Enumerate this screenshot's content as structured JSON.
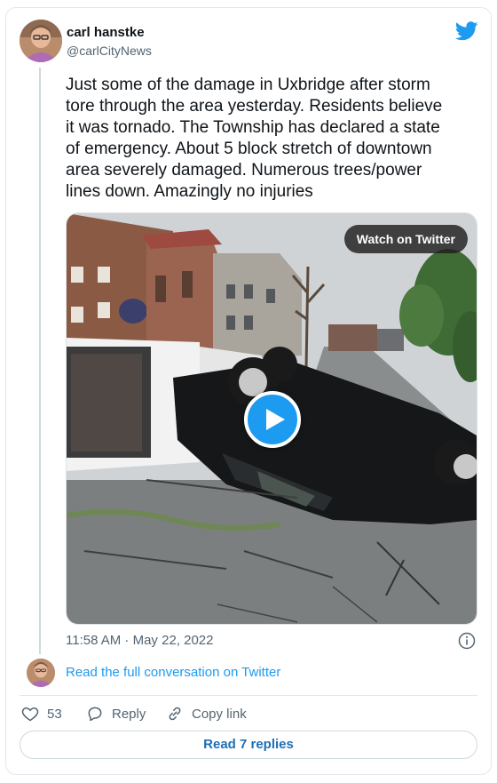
{
  "tweet": {
    "author_name": "carl hanstke",
    "author_handle": "@carlCityNews",
    "text": "Just some of the damage in Uxbridge after storm\ntore through the area yesterday.  Residents believe\nit was tornado.  The Township has declared a state\nof emergency.  About 5 block stretch of downtown\narea severely damaged. Numerous trees/power\nlines down.  Amazingly no injuries",
    "timestamp": "11:58 AM · May 22, 2022"
  },
  "media": {
    "watch_label": "Watch on Twitter"
  },
  "conversation_link": "Read the full conversation on Twitter",
  "actions": {
    "likes": "53",
    "reply_label": "Reply",
    "copy_label": "Copy link"
  },
  "replies_button": "Read 7 replies",
  "colors": {
    "brand": "#1d9bf0",
    "text": "#0f1419",
    "muted": "#536471",
    "border": "#e1e8ed"
  },
  "icons": [
    "twitter-bird-icon",
    "play-icon",
    "info-icon",
    "heart-icon",
    "reply-bubble-icon",
    "link-icon"
  ]
}
